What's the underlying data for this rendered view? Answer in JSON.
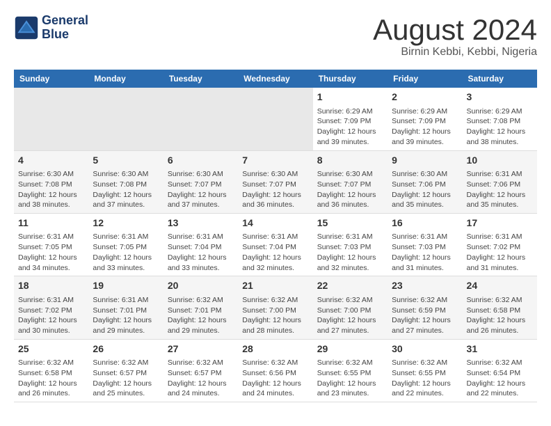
{
  "header": {
    "logo_line1": "General",
    "logo_line2": "Blue",
    "title": "August 2024",
    "subtitle": "Birnin Kebbi, Kebbi, Nigeria"
  },
  "days_of_week": [
    "Sunday",
    "Monday",
    "Tuesday",
    "Wednesday",
    "Thursday",
    "Friday",
    "Saturday"
  ],
  "weeks": [
    {
      "row_class": "week-row-1",
      "days": [
        {
          "num": "",
          "info": "",
          "empty": true
        },
        {
          "num": "",
          "info": "",
          "empty": true
        },
        {
          "num": "",
          "info": "",
          "empty": true
        },
        {
          "num": "",
          "info": "",
          "empty": true
        },
        {
          "num": "1",
          "info": "Sunrise: 6:29 AM\nSunset: 7:09 PM\nDaylight: 12 hours\nand 39 minutes."
        },
        {
          "num": "2",
          "info": "Sunrise: 6:29 AM\nSunset: 7:09 PM\nDaylight: 12 hours\nand 39 minutes."
        },
        {
          "num": "3",
          "info": "Sunrise: 6:29 AM\nSunset: 7:08 PM\nDaylight: 12 hours\nand 38 minutes."
        }
      ]
    },
    {
      "row_class": "week-row-2",
      "days": [
        {
          "num": "4",
          "info": "Sunrise: 6:30 AM\nSunset: 7:08 PM\nDaylight: 12 hours\nand 38 minutes."
        },
        {
          "num": "5",
          "info": "Sunrise: 6:30 AM\nSunset: 7:08 PM\nDaylight: 12 hours\nand 37 minutes."
        },
        {
          "num": "6",
          "info": "Sunrise: 6:30 AM\nSunset: 7:07 PM\nDaylight: 12 hours\nand 37 minutes."
        },
        {
          "num": "7",
          "info": "Sunrise: 6:30 AM\nSunset: 7:07 PM\nDaylight: 12 hours\nand 36 minutes."
        },
        {
          "num": "8",
          "info": "Sunrise: 6:30 AM\nSunset: 7:07 PM\nDaylight: 12 hours\nand 36 minutes."
        },
        {
          "num": "9",
          "info": "Sunrise: 6:30 AM\nSunset: 7:06 PM\nDaylight: 12 hours\nand 35 minutes."
        },
        {
          "num": "10",
          "info": "Sunrise: 6:31 AM\nSunset: 7:06 PM\nDaylight: 12 hours\nand 35 minutes."
        }
      ]
    },
    {
      "row_class": "week-row-3",
      "days": [
        {
          "num": "11",
          "info": "Sunrise: 6:31 AM\nSunset: 7:05 PM\nDaylight: 12 hours\nand 34 minutes."
        },
        {
          "num": "12",
          "info": "Sunrise: 6:31 AM\nSunset: 7:05 PM\nDaylight: 12 hours\nand 33 minutes."
        },
        {
          "num": "13",
          "info": "Sunrise: 6:31 AM\nSunset: 7:04 PM\nDaylight: 12 hours\nand 33 minutes."
        },
        {
          "num": "14",
          "info": "Sunrise: 6:31 AM\nSunset: 7:04 PM\nDaylight: 12 hours\nand 32 minutes."
        },
        {
          "num": "15",
          "info": "Sunrise: 6:31 AM\nSunset: 7:03 PM\nDaylight: 12 hours\nand 32 minutes."
        },
        {
          "num": "16",
          "info": "Sunrise: 6:31 AM\nSunset: 7:03 PM\nDaylight: 12 hours\nand 31 minutes."
        },
        {
          "num": "17",
          "info": "Sunrise: 6:31 AM\nSunset: 7:02 PM\nDaylight: 12 hours\nand 31 minutes."
        }
      ]
    },
    {
      "row_class": "week-row-4",
      "days": [
        {
          "num": "18",
          "info": "Sunrise: 6:31 AM\nSunset: 7:02 PM\nDaylight: 12 hours\nand 30 minutes."
        },
        {
          "num": "19",
          "info": "Sunrise: 6:31 AM\nSunset: 7:01 PM\nDaylight: 12 hours\nand 29 minutes."
        },
        {
          "num": "20",
          "info": "Sunrise: 6:32 AM\nSunset: 7:01 PM\nDaylight: 12 hours\nand 29 minutes."
        },
        {
          "num": "21",
          "info": "Sunrise: 6:32 AM\nSunset: 7:00 PM\nDaylight: 12 hours\nand 28 minutes."
        },
        {
          "num": "22",
          "info": "Sunrise: 6:32 AM\nSunset: 7:00 PM\nDaylight: 12 hours\nand 27 minutes."
        },
        {
          "num": "23",
          "info": "Sunrise: 6:32 AM\nSunset: 6:59 PM\nDaylight: 12 hours\nand 27 minutes."
        },
        {
          "num": "24",
          "info": "Sunrise: 6:32 AM\nSunset: 6:58 PM\nDaylight: 12 hours\nand 26 minutes."
        }
      ]
    },
    {
      "row_class": "week-row-5",
      "days": [
        {
          "num": "25",
          "info": "Sunrise: 6:32 AM\nSunset: 6:58 PM\nDaylight: 12 hours\nand 26 minutes."
        },
        {
          "num": "26",
          "info": "Sunrise: 6:32 AM\nSunset: 6:57 PM\nDaylight: 12 hours\nand 25 minutes."
        },
        {
          "num": "27",
          "info": "Sunrise: 6:32 AM\nSunset: 6:57 PM\nDaylight: 12 hours\nand 24 minutes."
        },
        {
          "num": "28",
          "info": "Sunrise: 6:32 AM\nSunset: 6:56 PM\nDaylight: 12 hours\nand 24 minutes."
        },
        {
          "num": "29",
          "info": "Sunrise: 6:32 AM\nSunset: 6:55 PM\nDaylight: 12 hours\nand 23 minutes."
        },
        {
          "num": "30",
          "info": "Sunrise: 6:32 AM\nSunset: 6:55 PM\nDaylight: 12 hours\nand 22 minutes."
        },
        {
          "num": "31",
          "info": "Sunrise: 6:32 AM\nSunset: 6:54 PM\nDaylight: 12 hours\nand 22 minutes."
        }
      ]
    }
  ]
}
